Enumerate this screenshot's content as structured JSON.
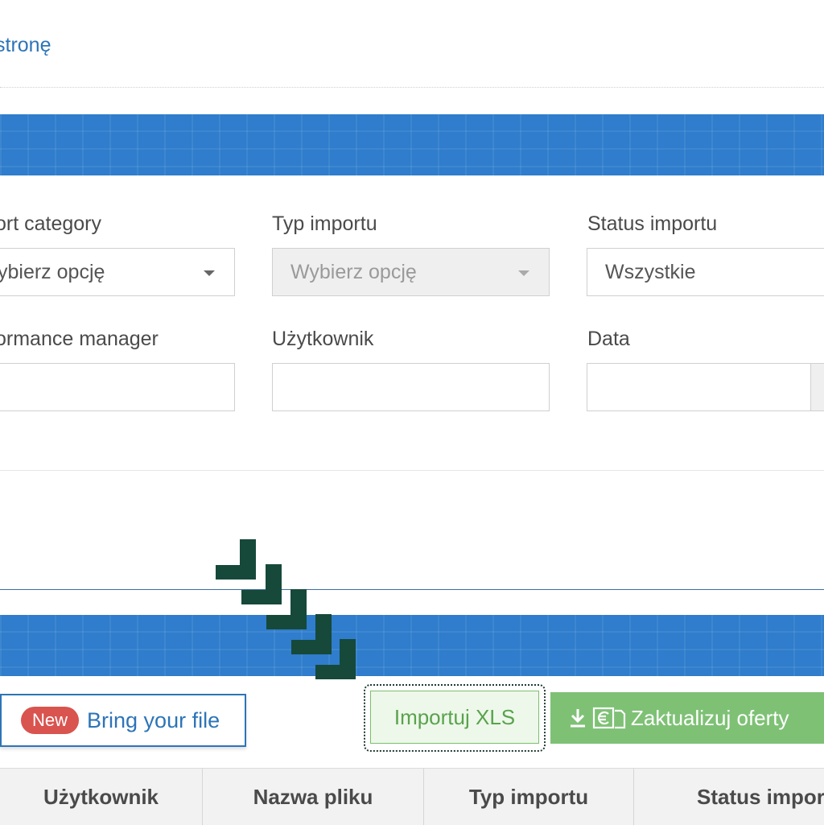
{
  "top_link": "stronę",
  "filters": {
    "category": {
      "label": "ort category",
      "value": "ybierz opcję"
    },
    "import_type": {
      "label": "Typ importu",
      "placeholder": "Wybierz opcję"
    },
    "import_status": {
      "label": "Status importu",
      "value": "Wszystkie"
    },
    "performance_manager": {
      "label": "ormance manager",
      "value": ""
    },
    "user": {
      "label": "Użytkownik",
      "value": ""
    },
    "date": {
      "label": "Data",
      "value": ""
    }
  },
  "actions": {
    "new_badge": "New",
    "bring_file": "Bring your file",
    "import_xls": "Importuj XLS",
    "update_offers": "Zaktualizuj oferty"
  },
  "table": {
    "columns": [
      "Użytkownik",
      "Nazwa pliku",
      "Typ importu",
      "Status impor"
    ]
  },
  "colors": {
    "brand_blue": "#2f7dcc",
    "link_blue": "#2d74b8",
    "success_green": "#7ec175",
    "badge_red": "#d9534f"
  },
  "icons": [
    "download-icon",
    "euro-document-icon",
    "dropdown-caret-icon",
    "stair-arrow-icon"
  ]
}
